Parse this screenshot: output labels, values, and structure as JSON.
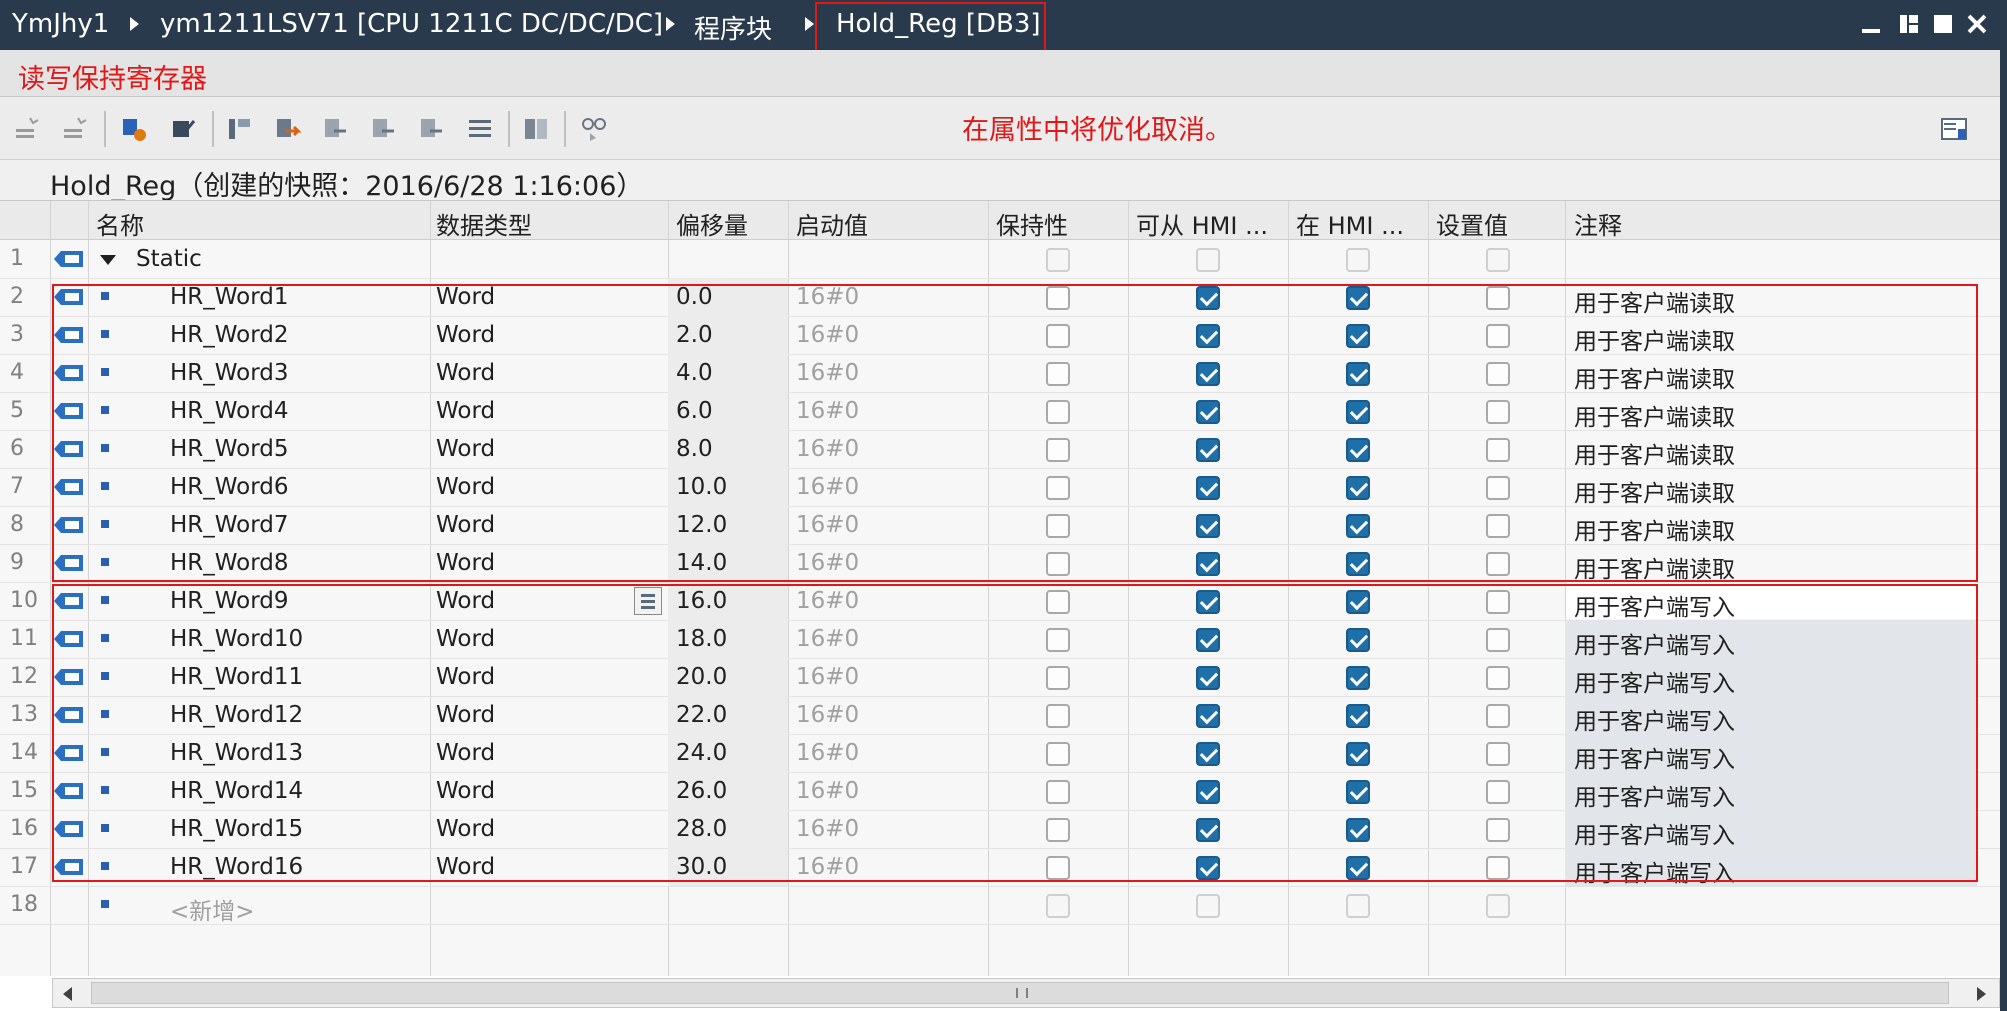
{
  "breadcrumb": {
    "project": "YmJhy1",
    "device": "ym1211LSV71 [CPU 1211C DC/DC/DC]",
    "folder": "程序块",
    "block": "Hold_Reg [DB3]"
  },
  "annotations": {
    "top_note": "读写保持寄存器",
    "toolbar_note": "在属性中将优化取消。"
  },
  "snapshot_title": "Hold_Reg（创建的快照：2016/6/28 1:16:06）",
  "columns": [
    "名称",
    "数据类型",
    "偏移量",
    "启动值",
    "保持性",
    "可从 HMI ...",
    "在 HMI ...",
    "设置值",
    "注释"
  ],
  "static_row": {
    "num": "1",
    "name": "Static"
  },
  "rows": [
    {
      "num": "2",
      "name": "HR_Word1",
      "type": "Word",
      "offset": "0.0",
      "start": "16#0",
      "comment": "用于客户端读取"
    },
    {
      "num": "3",
      "name": "HR_Word2",
      "type": "Word",
      "offset": "2.0",
      "start": "16#0",
      "comment": "用于客户端读取"
    },
    {
      "num": "4",
      "name": "HR_Word3",
      "type": "Word",
      "offset": "4.0",
      "start": "16#0",
      "comment": "用于客户端读取"
    },
    {
      "num": "5",
      "name": "HR_Word4",
      "type": "Word",
      "offset": "6.0",
      "start": "16#0",
      "comment": "用于客户端读取"
    },
    {
      "num": "6",
      "name": "HR_Word5",
      "type": "Word",
      "offset": "8.0",
      "start": "16#0",
      "comment": "用于客户端读取"
    },
    {
      "num": "7",
      "name": "HR_Word6",
      "type": "Word",
      "offset": "10.0",
      "start": "16#0",
      "comment": "用于客户端读取"
    },
    {
      "num": "8",
      "name": "HR_Word7",
      "type": "Word",
      "offset": "12.0",
      "start": "16#0",
      "comment": "用于客户端读取"
    },
    {
      "num": "9",
      "name": "HR_Word8",
      "type": "Word",
      "offset": "14.0",
      "start": "16#0",
      "comment": "用于客户端读取"
    },
    {
      "num": "10",
      "name": "HR_Word9",
      "type": "Word",
      "offset": "16.0",
      "start": "16#0",
      "comment": "用于客户端写入"
    },
    {
      "num": "11",
      "name": "HR_Word10",
      "type": "Word",
      "offset": "18.0",
      "start": "16#0",
      "comment": "用于客户端写入"
    },
    {
      "num": "12",
      "name": "HR_Word11",
      "type": "Word",
      "offset": "20.0",
      "start": "16#0",
      "comment": "用于客户端写入"
    },
    {
      "num": "13",
      "name": "HR_Word12",
      "type": "Word",
      "offset": "22.0",
      "start": "16#0",
      "comment": "用于客户端写入"
    },
    {
      "num": "14",
      "name": "HR_Word13",
      "type": "Word",
      "offset": "24.0",
      "start": "16#0",
      "comment": "用于客户端写入"
    },
    {
      "num": "15",
      "name": "HR_Word14",
      "type": "Word",
      "offset": "26.0",
      "start": "16#0",
      "comment": "用于客户端写入"
    },
    {
      "num": "16",
      "name": "HR_Word15",
      "type": "Word",
      "offset": "28.0",
      "start": "16#0",
      "comment": "用于客户端写入"
    },
    {
      "num": "17",
      "name": "HR_Word16",
      "type": "Word",
      "offset": "30.0",
      "start": "16#0",
      "comment": "用于客户端写入"
    }
  ],
  "add_row": {
    "num": "18",
    "name": "<新增>"
  },
  "checkbox_states": {
    "retain": false,
    "accessible_from_hmi": true,
    "visible_in_hmi": true,
    "setpoint": false
  },
  "colors": {
    "titlebar": "#2a3a4d",
    "annotation_red": "#e01818",
    "checkbox_blue": "#1f6fa8"
  }
}
